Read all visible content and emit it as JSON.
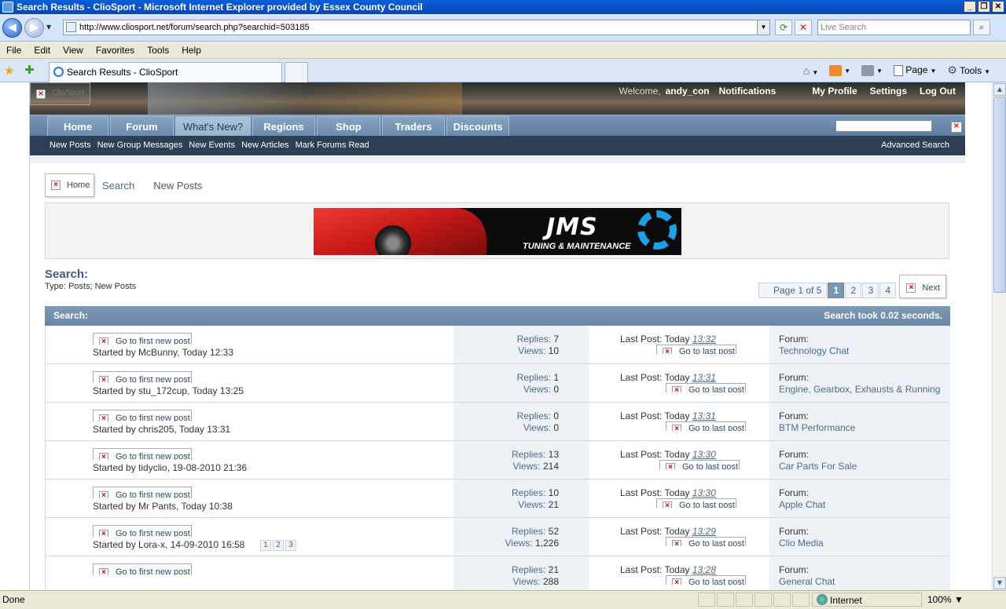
{
  "window": {
    "title": "Search Results - ClioSport - Microsoft Internet Explorer provided by Essex County Council",
    "url": "http://www.cliosport.net/forum/search.php?searchid=503185",
    "live_search_placeholder": "Live Search",
    "menu": [
      "File",
      "Edit",
      "View",
      "Favorites",
      "Tools",
      "Help"
    ],
    "tab_title": "Search Results - ClioSport",
    "cmd_page": "Page",
    "cmd_tools": "Tools",
    "status": "Done",
    "zone": "Internet",
    "zoom": "100%"
  },
  "header": {
    "logo_alt": "ClioSport",
    "welcome": "Welcome,",
    "username": "andy_con",
    "notifications": "Notifications",
    "links": [
      "My Profile",
      "Settings",
      "Log Out"
    ]
  },
  "nav": {
    "tabs": [
      "Home",
      "Forum",
      "What's New?",
      "Regions",
      "Shop",
      "Traders",
      "Discounts"
    ],
    "active": "What's New?",
    "sub_links": [
      "New Posts",
      "New Group Messages",
      "New Events",
      "New Articles",
      "Mark Forums Read"
    ],
    "advanced_search": "Advanced Search"
  },
  "breadcrumb": {
    "home": "Home",
    "search": "Search",
    "current": "New Posts"
  },
  "banner": {
    "brand": "JMS",
    "tagline": "TUNING & MAINTENANCE"
  },
  "search": {
    "title": "Search:",
    "type_label": "Type:",
    "type_value": "Posts; New Posts",
    "pager_info": "Page 1 of 5",
    "pages": [
      "1",
      "2",
      "3",
      "4"
    ],
    "next": "Next",
    "head_left": "Search:",
    "head_right": "Search took 0.02 seconds."
  },
  "labels": {
    "go_first": "Go to first new post",
    "go_last": "Go to last post",
    "replies": "Replies:",
    "views": "Views:",
    "last_post": "Last Post:",
    "today": "Today",
    "forum": "Forum:"
  },
  "results": [
    {
      "started": "Started by McBunny, Today 12:33",
      "replies": "7",
      "views": "10",
      "time": "13:32",
      "forum": "Technology Chat",
      "pages": []
    },
    {
      "started": "Started by stu_172cup, Today 13:25",
      "replies": "1",
      "views": "0",
      "time": "13:31",
      "forum": "Engine, Gearbox, Exhausts & Running",
      "pages": []
    },
    {
      "started": "Started by chris205, Today 13:31",
      "replies": "0",
      "views": "0",
      "time": "13:31",
      "forum": "BTM Performance",
      "pages": []
    },
    {
      "started": "Started by tidyclio, 19-08-2010 21:36",
      "replies": "13",
      "views": "214",
      "time": "13:30",
      "forum": "Car Parts For Sale",
      "pages": []
    },
    {
      "started": "Started by Mr Pants, Today 10:38",
      "replies": "10",
      "views": "21",
      "time": "13:30",
      "forum": "Apple Chat",
      "pages": []
    },
    {
      "started": "Started by Lora-x, 14-09-2010 16:58",
      "replies": "52",
      "views": "1,226",
      "time": "13:29",
      "forum": "Clio Media",
      "pages": [
        "1",
        "2",
        "3"
      ]
    },
    {
      "started": "",
      "replies": "21",
      "views": "288",
      "time": "13:28",
      "forum": "General Chat",
      "pages": []
    }
  ]
}
